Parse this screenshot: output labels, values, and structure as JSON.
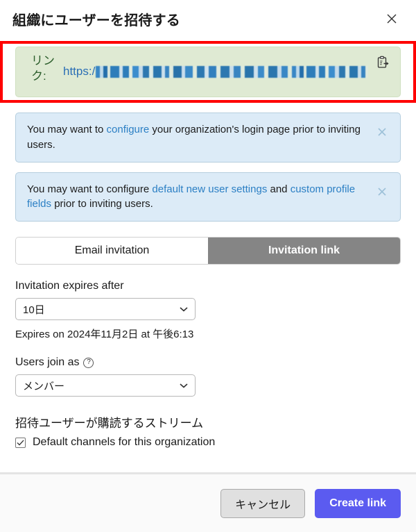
{
  "header": {
    "title": "組織にユーザーを招待する",
    "close_icon": "close-icon"
  },
  "link_banner": {
    "label": "リンク:",
    "url_protocol": "https:/",
    "url_redacted": true,
    "copy_icon": "clipboard-copy-icon"
  },
  "notices": [
    {
      "prefix": "You may want to ",
      "link1": "configure",
      "middle": " your organization's login page prior to inviting users.",
      "link2": "",
      "suffix": "",
      "close_icon": "close-icon"
    },
    {
      "prefix": "You may want to configure ",
      "link1": "default new user settings",
      "middle": " and ",
      "link2": "custom profile fields",
      "suffix": " prior to inviting users.",
      "close_icon": "close-icon"
    }
  ],
  "tabs": [
    {
      "label": "Email invitation",
      "active": false
    },
    {
      "label": "Invitation link",
      "active": true
    }
  ],
  "expiry": {
    "label": "Invitation expires after",
    "value": "10日",
    "note": "Expires on 2024年11月2日 at 午後6:13"
  },
  "role": {
    "label": "Users join as",
    "help_icon": "question-mark-icon",
    "value": "メンバー"
  },
  "streams": {
    "heading": "招待ユーザーが購読するストリーム",
    "checkbox_label": "Default channels for this organization",
    "checked": true
  },
  "footer": {
    "cancel_label": "キャンセル",
    "submit_label": "Create link"
  },
  "colors": {
    "link_banner_bg": "#dfead3",
    "link_banner_text": "#2c5e2c",
    "notice_bg": "#dcebf7",
    "notice_link": "#2b7fc4",
    "active_tab_bg": "#858585",
    "primary_button_bg": "#5b5bf0",
    "annotation_outline": "#ff0000"
  }
}
